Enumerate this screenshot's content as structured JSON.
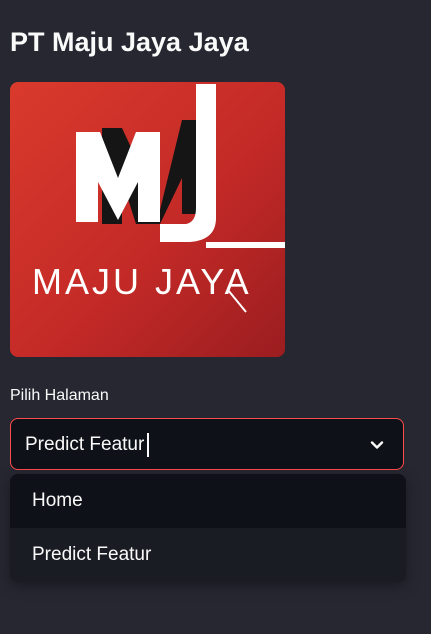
{
  "app": {
    "title": "PT Maju Jaya Jaya"
  },
  "logo": {
    "icon": "maju-jaya-logo",
    "monogram": "MJ",
    "wordmark": "MAJU JAYA",
    "colors": {
      "red_light": "#d9312a",
      "red_dark": "#9b1d20",
      "white": "#ffffff",
      "shadow": "#111111"
    }
  },
  "page_select": {
    "label": "Pilih Halaman",
    "value": "Predict Featur",
    "options": [
      "Home",
      "Predict Featur"
    ],
    "highlighted_option": "Home",
    "open": true,
    "icon": "chevron-down-icon",
    "border_color": "#ff4b4b"
  },
  "theme": {
    "background": "#262730",
    "input_background": "#0e1117",
    "text": "#fafafa",
    "accent": "#ff4b4b"
  }
}
